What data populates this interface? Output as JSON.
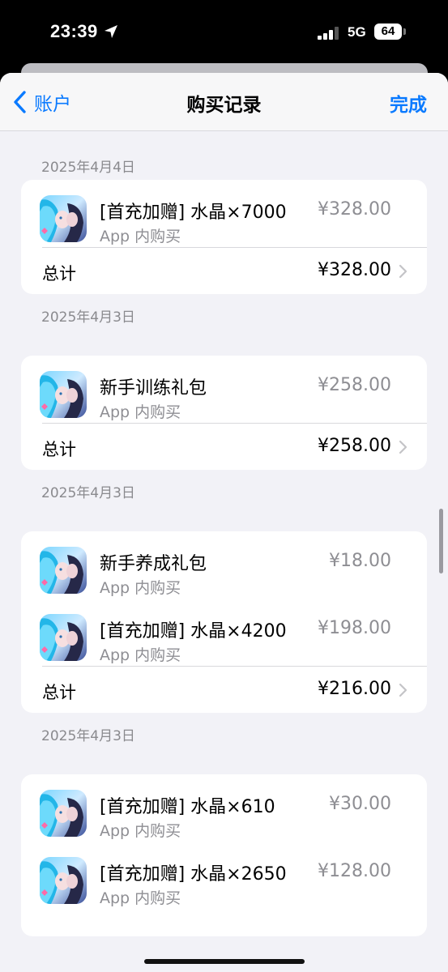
{
  "status_bar": {
    "time": "23:39",
    "network": "5G",
    "battery": "64"
  },
  "nav": {
    "back_label": "账户",
    "title": "购买记录",
    "done_label": "完成"
  },
  "colors": {
    "accent": "#0a7aff",
    "secondary_text": "#8e8e93",
    "background": "#f2f2f7"
  },
  "groups": [
    {
      "date": "2025年4月4日",
      "items": [
        {
          "name": "[首充加赠] 水晶×7000",
          "subtitle": "App 内购买",
          "price": "¥328.00"
        }
      ],
      "total_label": "总计",
      "total": "¥328.00"
    },
    {
      "date": "2025年4月3日",
      "items": [
        {
          "name": "新手训练礼包",
          "subtitle": "App 内购买",
          "price": "¥258.00"
        }
      ],
      "total_label": "总计",
      "total": "¥258.00"
    },
    {
      "date": "2025年4月3日",
      "items": [
        {
          "name": "新手养成礼包",
          "subtitle": "App 内购买",
          "price": "¥18.00"
        },
        {
          "name": "[首充加赠] 水晶×4200",
          "subtitle": "App 内购买",
          "price": "¥198.00"
        }
      ],
      "total_label": "总计",
      "total": "¥216.00"
    },
    {
      "date": "2025年4月3日",
      "items": [
        {
          "name": "[首充加赠] 水晶×610",
          "subtitle": "App 内购买",
          "price": "¥30.00"
        },
        {
          "name": "[首充加赠] 水晶×2650",
          "subtitle": "App 内购买",
          "price": "¥128.00"
        }
      ]
    }
  ]
}
